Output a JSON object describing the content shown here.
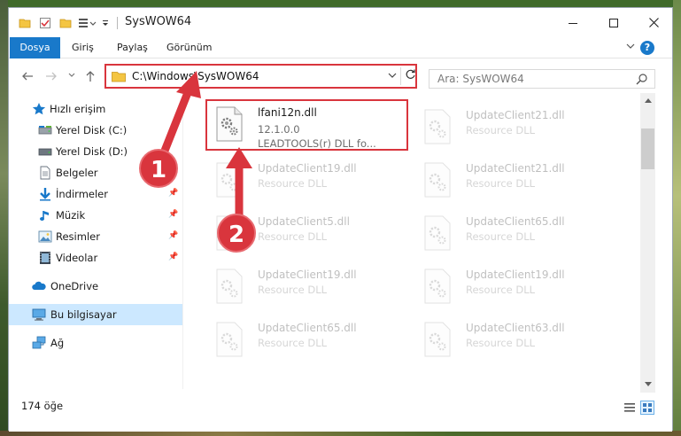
{
  "window": {
    "title": "SysWOW64"
  },
  "ribbon": {
    "tabs": [
      {
        "label": "Dosya",
        "active": true
      },
      {
        "label": "Giriş"
      },
      {
        "label": "Paylaş"
      },
      {
        "label": "Görünüm"
      }
    ],
    "help_label": "?"
  },
  "nav": {
    "address": "C:\\Windows\\SysWOW64",
    "search_placeholder": "Ara: SysWOW64"
  },
  "sidebar": {
    "items": [
      {
        "label": "Hızlı erişim",
        "icon": "star-icon"
      },
      {
        "label": "Yerel Disk (C:)",
        "icon": "drive-icon"
      },
      {
        "label": "Yerel Disk (D:)",
        "icon": "drive-icon"
      },
      {
        "label": "Belgeler",
        "icon": "documents-icon"
      },
      {
        "label": "İndirmeler",
        "icon": "download-icon"
      },
      {
        "label": "Müzik",
        "icon": "music-icon"
      },
      {
        "label": "Resimler",
        "icon": "pictures-icon"
      },
      {
        "label": "Videolar",
        "icon": "videos-icon"
      },
      {
        "label": "OneDrive",
        "icon": "onedrive-icon"
      },
      {
        "label": "Bu bilgisayar",
        "icon": "computer-icon",
        "selected": true
      },
      {
        "label": "Ağ",
        "icon": "network-icon"
      }
    ]
  },
  "files": [
    {
      "name": "lfani12n.dll",
      "line2": "12.1.0.0",
      "line3": "LEADTOOLS(r) DLL fo..."
    },
    {
      "name": "UpdateClient21.dll",
      "line2": "Resource DLL"
    },
    {
      "name": "UpdateClient19.dll",
      "line2": "Resource DLL"
    },
    {
      "name": "UpdateClient21.dll",
      "line2": "Resource DLL"
    },
    {
      "name": "UpdateClient5.dll",
      "line2": "Resource DLL"
    },
    {
      "name": "UpdateClient65.dll",
      "line2": "Resource DLL"
    },
    {
      "name": "UpdateClient19.dll",
      "line2": "Resource DLL"
    },
    {
      "name": "UpdateClient19.dll",
      "line2": "Resource DLL"
    },
    {
      "name": "UpdateClient65.dll",
      "line2": "Resource DLL"
    },
    {
      "name": "UpdateClient63.dll",
      "line2": "Resource DLL"
    }
  ],
  "status": {
    "item_count": "174 öğe"
  },
  "annotations": {
    "badge1": "1",
    "badge2": "2",
    "color": "#d9353d"
  },
  "colors": {
    "accent": "#1979ca",
    "highlight": "#d9353d",
    "selected": "#cce8ff"
  }
}
